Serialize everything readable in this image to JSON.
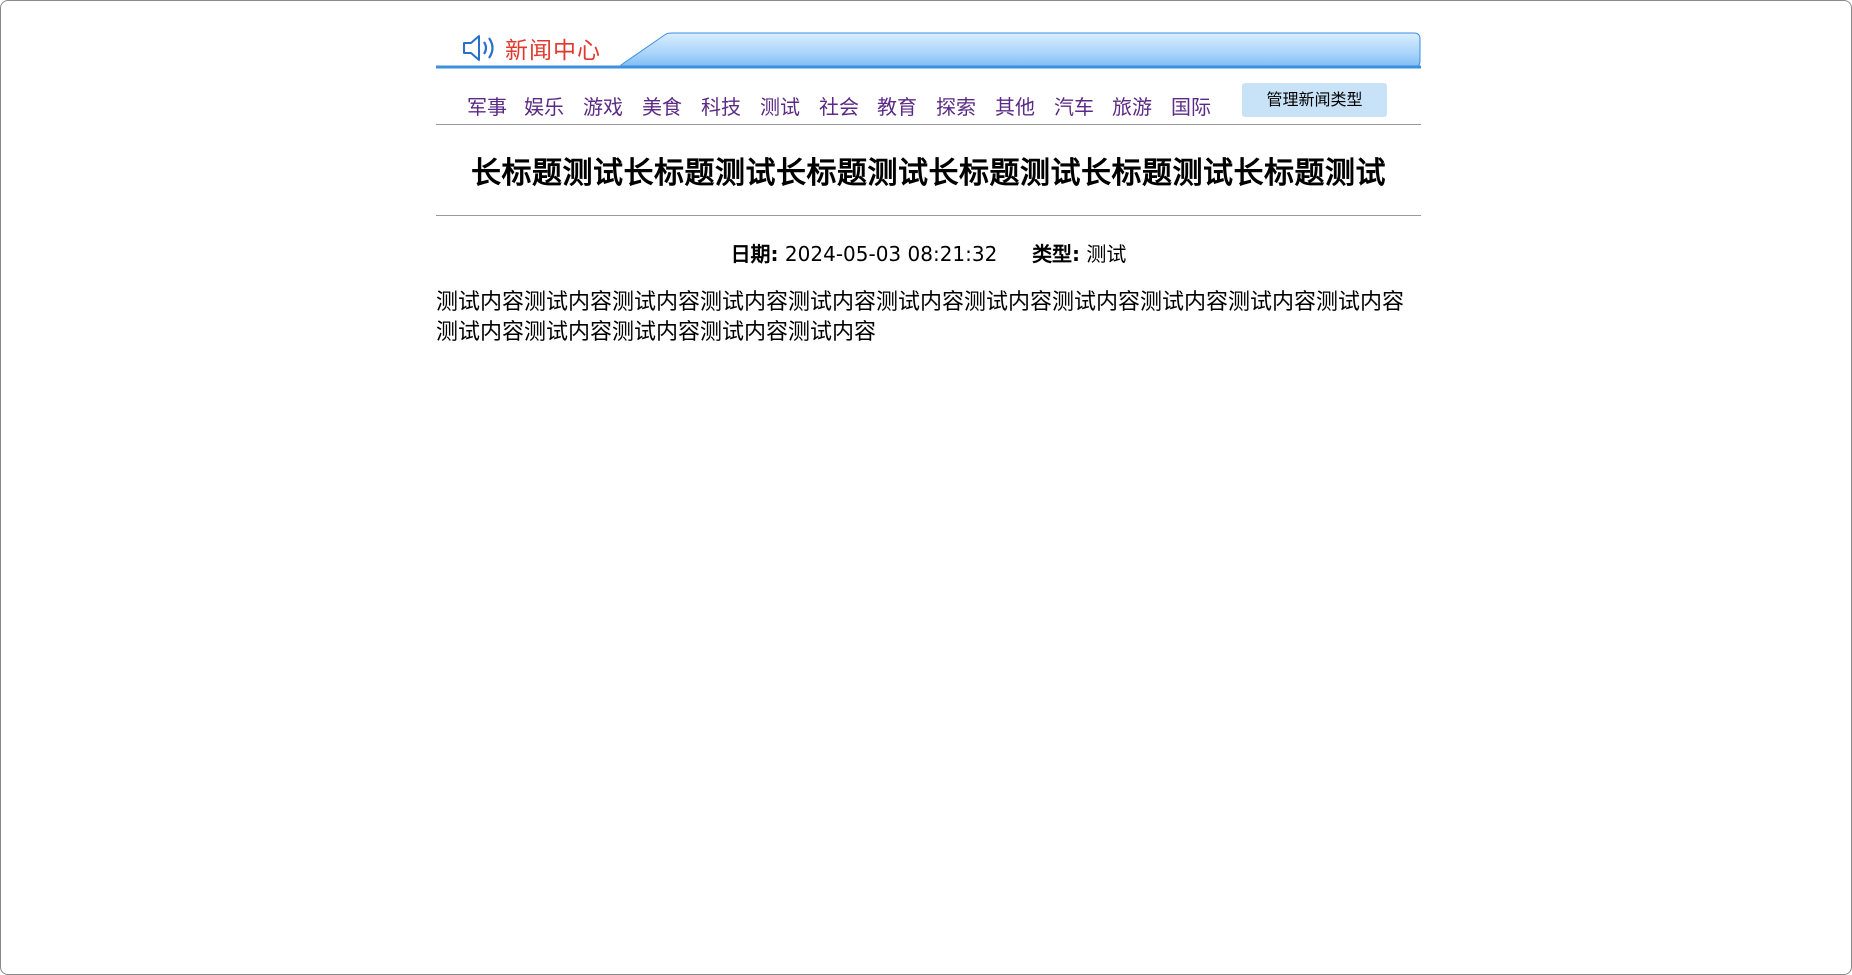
{
  "header": {
    "logo_text": "新闻中心"
  },
  "nav": {
    "items": [
      "军事",
      "娱乐",
      "游戏",
      "美食",
      "科技",
      "测试",
      "社会",
      "教育",
      "探索",
      "其他",
      "汽车",
      "旅游",
      "国际"
    ],
    "manage_label": "管理新闻类型"
  },
  "article": {
    "title": "长标题测试长标题测试长标题测试长标题测试长标题测试长标题测试",
    "date_label": "日期:",
    "date_value": "2024-05-03 08:21:32",
    "type_label": "类型:",
    "type_value": "测试",
    "content": "测试内容测试内容测试内容测试内容测试内容测试内容测试内容测试内容测试内容测试内容测试内容测试内容测试内容测试内容测试内容测试内容"
  },
  "colors": {
    "banner_light": "#d6ecff",
    "banner_dark": "#7dbdf5",
    "banner_edge": "#3d8fe0",
    "nav_link": "#5b2a86",
    "logo_red": "#e03a2e",
    "button_bg": "#c8e3f7"
  }
}
